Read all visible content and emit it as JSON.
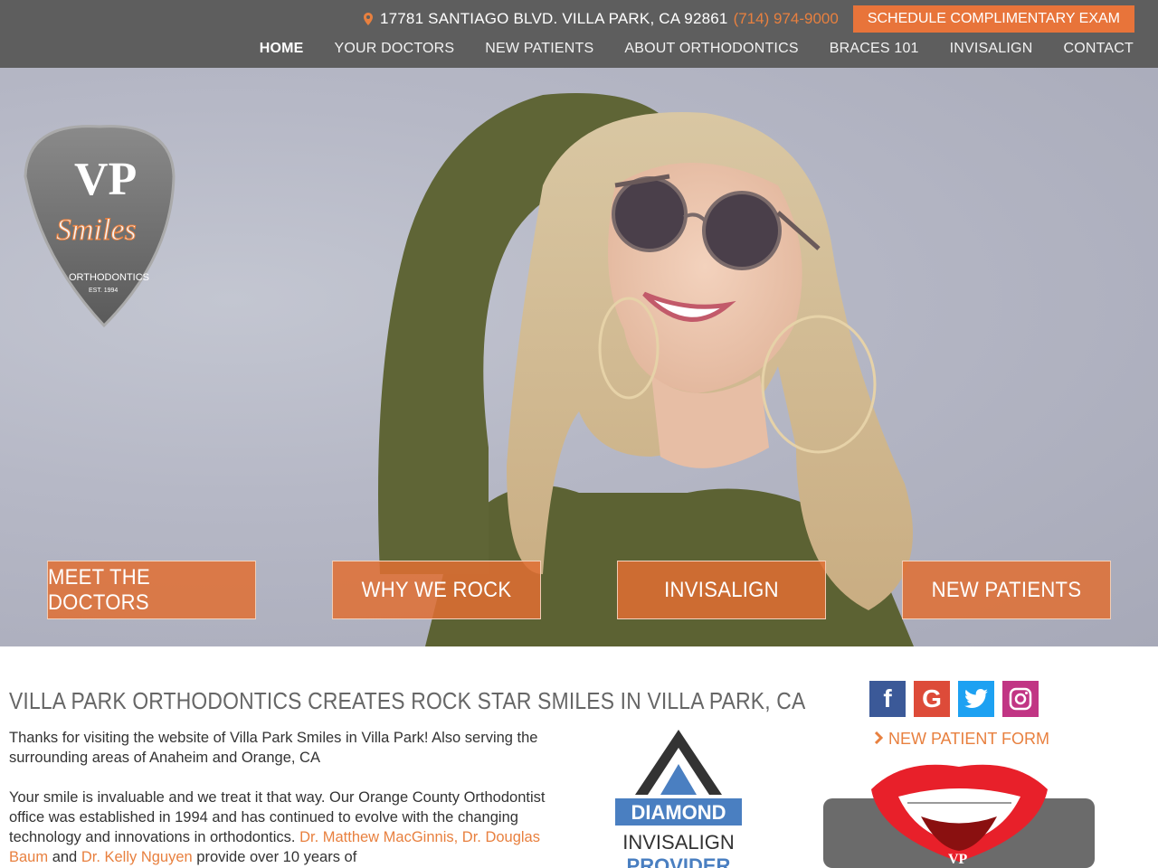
{
  "header": {
    "address": "17781 SANTIAGO BLVD. VILLA PARK, CA 92861",
    "phone": "(714) 974-9000",
    "cta": "SCHEDULE COMPLIMENTARY EXAM"
  },
  "nav": [
    "HOME",
    "YOUR DOCTORS",
    "NEW PATIENTS",
    "ABOUT ORTHODONTICS",
    "BRACES 101",
    "INVISALIGN",
    "CONTACT"
  ],
  "logo": {
    "mark": "VP",
    "script": "Smiles",
    "sub": "ORTHODONTICS",
    "est": "EST. 1994"
  },
  "hero_buttons": [
    "MEET THE DOCTORS",
    "WHY WE ROCK",
    "INVISALIGN",
    "NEW PATIENTS"
  ],
  "main": {
    "headline": "VILLA PARK ORTHODONTICS CREATES ROCK STAR SMILES IN VILLA PARK, CA",
    "p1": "Thanks for visiting the website of Villa Park Smiles in Villa Park!  Also serving the surrounding areas of Anaheim and Orange, CA",
    "p2_a": "Your smile is invaluable and we treat it that way. Our Orange County Orthodontist office was established in 1994 and has continued to evolve with the changing technology and innovations in orthodontics. ",
    "p2_link1": "Dr. Matthew MacGinnis, Dr. Douglas Baum",
    "p2_b": " and ",
    "p2_link2": "Dr. Kelly Nguyen",
    "p2_c": " provide over 10 years of"
  },
  "badge": {
    "line1": "DIAMOND",
    "line2": "INVISALIGN",
    "line3": "PROVIDER"
  },
  "social": {
    "facebook": "f",
    "google": "G",
    "twitter": "t",
    "instagram": "ig"
  },
  "new_patient_form": "NEW PATIENT FORM",
  "lips_badge": "VP",
  "colors": {
    "accent": "#e8743a",
    "topbar": "#5e5e5e"
  }
}
